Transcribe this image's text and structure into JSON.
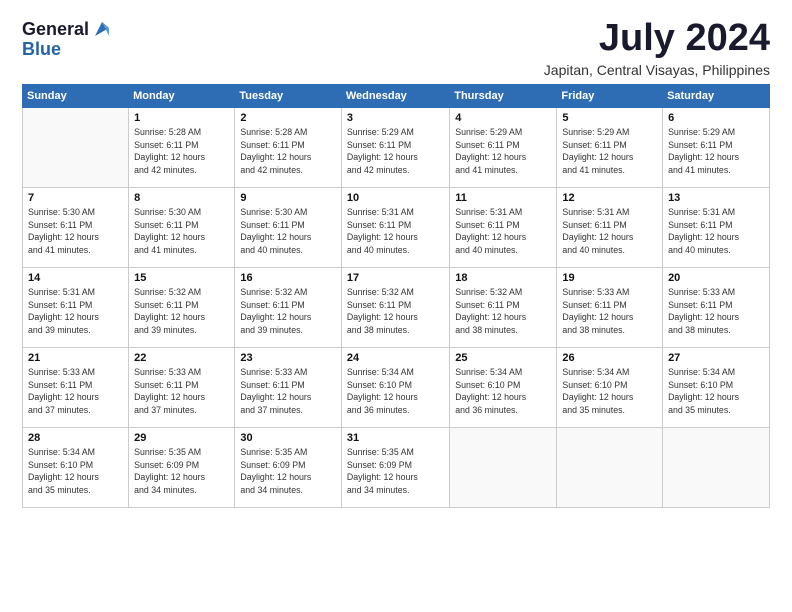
{
  "logo": {
    "general": "General",
    "blue": "Blue"
  },
  "header": {
    "month": "July 2024",
    "location": "Japitan, Central Visayas, Philippines"
  },
  "weekdays": [
    "Sunday",
    "Monday",
    "Tuesday",
    "Wednesday",
    "Thursday",
    "Friday",
    "Saturday"
  ],
  "weeks": [
    [
      {
        "day": "",
        "info": ""
      },
      {
        "day": "1",
        "info": "Sunrise: 5:28 AM\nSunset: 6:11 PM\nDaylight: 12 hours\nand 42 minutes."
      },
      {
        "day": "2",
        "info": "Sunrise: 5:28 AM\nSunset: 6:11 PM\nDaylight: 12 hours\nand 42 minutes."
      },
      {
        "day": "3",
        "info": "Sunrise: 5:29 AM\nSunset: 6:11 PM\nDaylight: 12 hours\nand 42 minutes."
      },
      {
        "day": "4",
        "info": "Sunrise: 5:29 AM\nSunset: 6:11 PM\nDaylight: 12 hours\nand 41 minutes."
      },
      {
        "day": "5",
        "info": "Sunrise: 5:29 AM\nSunset: 6:11 PM\nDaylight: 12 hours\nand 41 minutes."
      },
      {
        "day": "6",
        "info": "Sunrise: 5:29 AM\nSunset: 6:11 PM\nDaylight: 12 hours\nand 41 minutes."
      }
    ],
    [
      {
        "day": "7",
        "info": "Sunrise: 5:30 AM\nSunset: 6:11 PM\nDaylight: 12 hours\nand 41 minutes."
      },
      {
        "day": "8",
        "info": "Sunrise: 5:30 AM\nSunset: 6:11 PM\nDaylight: 12 hours\nand 41 minutes."
      },
      {
        "day": "9",
        "info": "Sunrise: 5:30 AM\nSunset: 6:11 PM\nDaylight: 12 hours\nand 40 minutes."
      },
      {
        "day": "10",
        "info": "Sunrise: 5:31 AM\nSunset: 6:11 PM\nDaylight: 12 hours\nand 40 minutes."
      },
      {
        "day": "11",
        "info": "Sunrise: 5:31 AM\nSunset: 6:11 PM\nDaylight: 12 hours\nand 40 minutes."
      },
      {
        "day": "12",
        "info": "Sunrise: 5:31 AM\nSunset: 6:11 PM\nDaylight: 12 hours\nand 40 minutes."
      },
      {
        "day": "13",
        "info": "Sunrise: 5:31 AM\nSunset: 6:11 PM\nDaylight: 12 hours\nand 40 minutes."
      }
    ],
    [
      {
        "day": "14",
        "info": "Sunrise: 5:31 AM\nSunset: 6:11 PM\nDaylight: 12 hours\nand 39 minutes."
      },
      {
        "day": "15",
        "info": "Sunrise: 5:32 AM\nSunset: 6:11 PM\nDaylight: 12 hours\nand 39 minutes."
      },
      {
        "day": "16",
        "info": "Sunrise: 5:32 AM\nSunset: 6:11 PM\nDaylight: 12 hours\nand 39 minutes."
      },
      {
        "day": "17",
        "info": "Sunrise: 5:32 AM\nSunset: 6:11 PM\nDaylight: 12 hours\nand 38 minutes."
      },
      {
        "day": "18",
        "info": "Sunrise: 5:32 AM\nSunset: 6:11 PM\nDaylight: 12 hours\nand 38 minutes."
      },
      {
        "day": "19",
        "info": "Sunrise: 5:33 AM\nSunset: 6:11 PM\nDaylight: 12 hours\nand 38 minutes."
      },
      {
        "day": "20",
        "info": "Sunrise: 5:33 AM\nSunset: 6:11 PM\nDaylight: 12 hours\nand 38 minutes."
      }
    ],
    [
      {
        "day": "21",
        "info": "Sunrise: 5:33 AM\nSunset: 6:11 PM\nDaylight: 12 hours\nand 37 minutes."
      },
      {
        "day": "22",
        "info": "Sunrise: 5:33 AM\nSunset: 6:11 PM\nDaylight: 12 hours\nand 37 minutes."
      },
      {
        "day": "23",
        "info": "Sunrise: 5:33 AM\nSunset: 6:11 PM\nDaylight: 12 hours\nand 37 minutes."
      },
      {
        "day": "24",
        "info": "Sunrise: 5:34 AM\nSunset: 6:10 PM\nDaylight: 12 hours\nand 36 minutes."
      },
      {
        "day": "25",
        "info": "Sunrise: 5:34 AM\nSunset: 6:10 PM\nDaylight: 12 hours\nand 36 minutes."
      },
      {
        "day": "26",
        "info": "Sunrise: 5:34 AM\nSunset: 6:10 PM\nDaylight: 12 hours\nand 35 minutes."
      },
      {
        "day": "27",
        "info": "Sunrise: 5:34 AM\nSunset: 6:10 PM\nDaylight: 12 hours\nand 35 minutes."
      }
    ],
    [
      {
        "day": "28",
        "info": "Sunrise: 5:34 AM\nSunset: 6:10 PM\nDaylight: 12 hours\nand 35 minutes."
      },
      {
        "day": "29",
        "info": "Sunrise: 5:35 AM\nSunset: 6:09 PM\nDaylight: 12 hours\nand 34 minutes."
      },
      {
        "day": "30",
        "info": "Sunrise: 5:35 AM\nSunset: 6:09 PM\nDaylight: 12 hours\nand 34 minutes."
      },
      {
        "day": "31",
        "info": "Sunrise: 5:35 AM\nSunset: 6:09 PM\nDaylight: 12 hours\nand 34 minutes."
      },
      {
        "day": "",
        "info": ""
      },
      {
        "day": "",
        "info": ""
      },
      {
        "day": "",
        "info": ""
      }
    ]
  ]
}
